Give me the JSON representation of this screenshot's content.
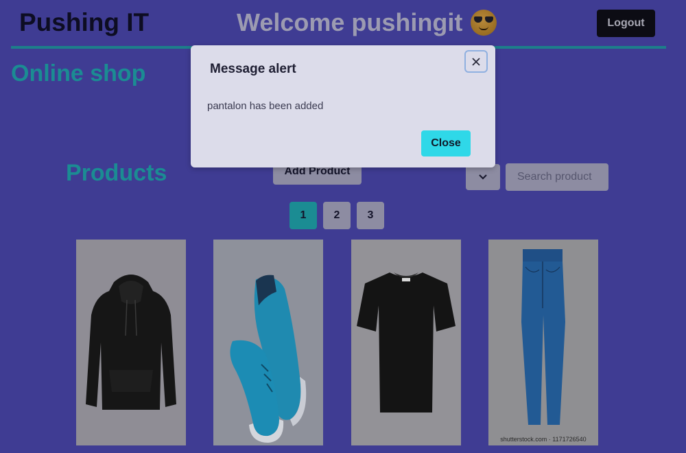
{
  "header": {
    "brand": "Pushing IT",
    "welcome": "Welcome pushingit",
    "logout_label": "Logout"
  },
  "shop_title": "Online shop",
  "products": {
    "title": "Products",
    "add_label": "Add Product",
    "search_placeholder": "Search product",
    "pages": [
      "1",
      "2",
      "3"
    ],
    "active_page": "1",
    "items": [
      {
        "name": "hoodie"
      },
      {
        "name": "sneakers"
      },
      {
        "name": "t-shirt"
      },
      {
        "name": "pantalon",
        "watermark": "shutterstock.com · 1171726540"
      }
    ]
  },
  "modal": {
    "title": "Message alert",
    "message": "pantalon has been added",
    "close_label": "Close"
  },
  "icons": {
    "emoji": "sunglasses-face-icon",
    "dropdown": "chevron-down-icon",
    "close": "close-icon"
  },
  "colors": {
    "background": "#3f3c93",
    "accent": "#1b8c93",
    "modal_button": "#2fd8e8"
  }
}
